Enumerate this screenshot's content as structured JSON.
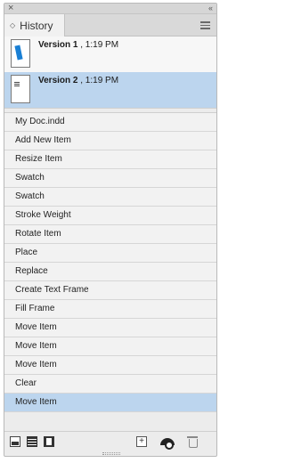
{
  "panel": {
    "close_glyph": "×",
    "collapse_glyph": "‹‹",
    "tab_title": "History",
    "tab_arrows": "◇"
  },
  "snapshots": [
    {
      "name": "Version 1",
      "time": ", 1:19 PM"
    },
    {
      "name": "Version 2",
      "time": ", 1:19 PM"
    }
  ],
  "history_items": [
    "My Doc.indd",
    "Add New Item",
    "Resize Item",
    "Swatch",
    "Swatch",
    "Stroke Weight",
    "Rotate Item",
    "Place",
    "Replace",
    "Create Text Frame",
    "Fill Frame",
    "Move Item",
    "Move Item",
    "Move Item",
    "Clear",
    "Move Item"
  ],
  "selected_history_index": 15,
  "selected_snapshot_index": 1,
  "toolbar": {
    "icons": [
      "new-document-from-state-icon",
      "create-snapshot-icon",
      "book-icon",
      "new-snapshot-icon",
      "eye-icon",
      "trash-icon"
    ],
    "new_glyph": "+"
  },
  "colors": {
    "selection": "#bcd5ee",
    "thumbnail_accent": "#1a7fd4"
  }
}
